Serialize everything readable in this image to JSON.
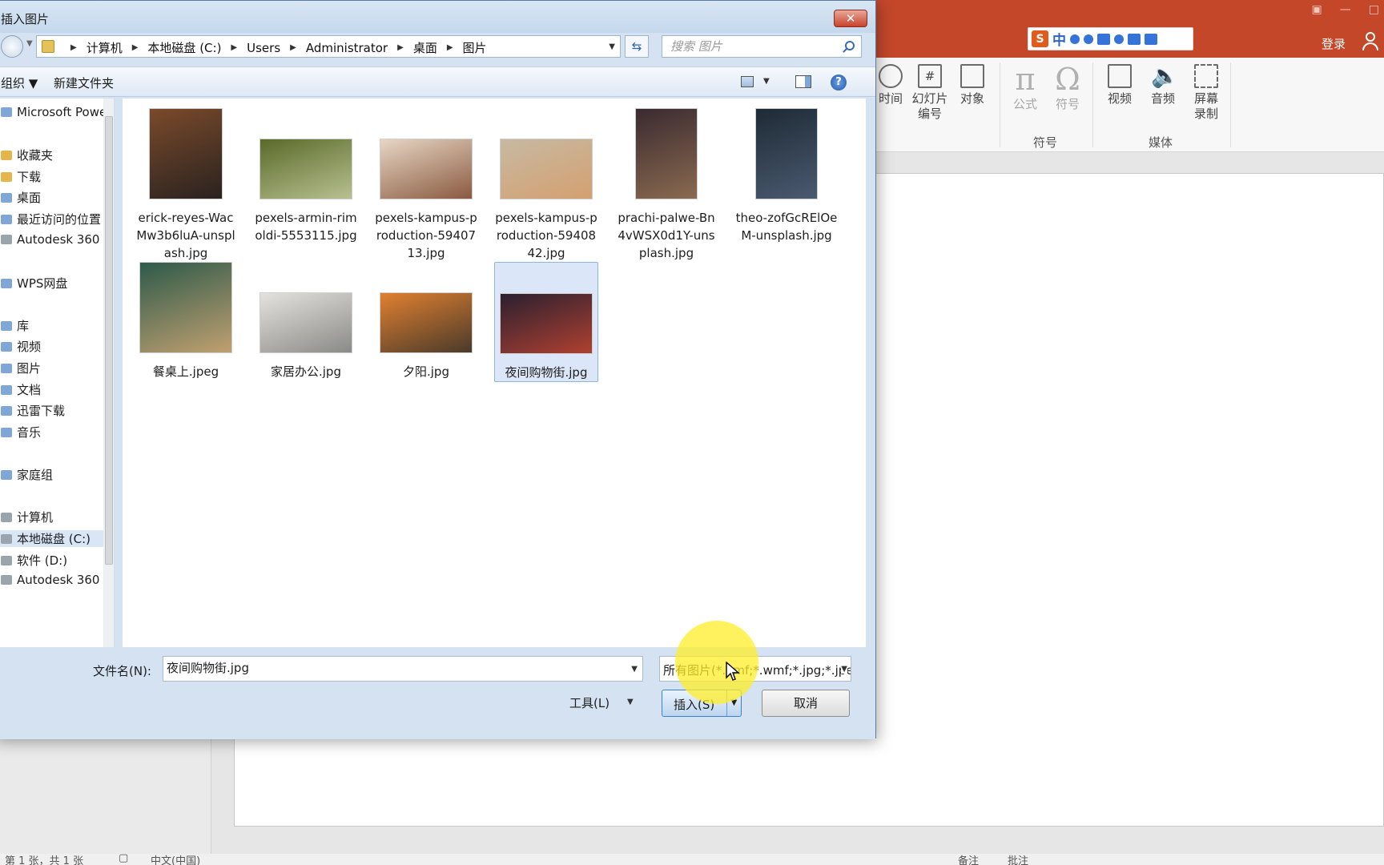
{
  "ppt": {
    "login_label": "登录",
    "ribbon": {
      "buttons": {
        "time": "时间",
        "slide_num_1": "幻灯片",
        "slide_num_2": "编号",
        "object": "对象",
        "equation": "公式",
        "symbol": "符号",
        "video": "视频",
        "audio": "音频",
        "screen_rec_1": "屏幕",
        "screen_rec_2": "录制"
      },
      "groups": {
        "symbols": "符号",
        "media": "媒体"
      }
    },
    "ime": {
      "zh": "中"
    },
    "status": {
      "slide_info": "第 1 张，共 1 张",
      "language": "中文(中国)",
      "notes": "备注",
      "comments": "批注"
    }
  },
  "dialog": {
    "title": "插入图片",
    "close_label": "✕",
    "breadcrumbs": [
      "计算机",
      "本地磁盘 (C:)",
      "Users",
      "Administrator",
      "桌面",
      "图片"
    ],
    "search_placeholder": "搜索 图片",
    "toolbar": {
      "organize": "组织 ▼",
      "new_folder": "新建文件夹"
    },
    "nav": {
      "items": [
        "Microsoft PowerPoint",
        "收藏夹",
        "下载",
        "桌面",
        "最近访问的位置",
        "Autodesk 360",
        "WPS网盘",
        "库",
        "视频",
        "图片",
        "文档",
        "迅雷下载",
        "音乐",
        "家庭组",
        "计算机",
        "本地磁盘 (C:)",
        "软件 (D:)",
        "Autodesk 360"
      ],
      "selected_index": 15
    },
    "files": [
      {
        "name": "erick-reyes-WacMw3b6luA-unsplash.jpg",
        "colors": [
          "#7a4a2a",
          "#2a2220"
        ]
      },
      {
        "name": "pexels-armin-rimoldi-5553115.jpg",
        "colors": [
          "#5a6a2a",
          "#b8c090"
        ]
      },
      {
        "name": "pexels-kampus-production-5940713.jpg",
        "colors": [
          "#e7d6c4",
          "#8a5a40"
        ]
      },
      {
        "name": "pexels-kampus-production-5940842.jpg",
        "colors": [
          "#c7b9a2",
          "#d4a070"
        ]
      },
      {
        "name": "prachi-palwe-Bn4vWSX0d1Y-unsplash.jpg",
        "colors": [
          "#3a2a30",
          "#8a6a50"
        ]
      },
      {
        "name": "theo-zofGcRElOeM-unsplash.jpg",
        "colors": [
          "#1e2a35",
          "#4a5a70"
        ]
      },
      {
        "name": "餐桌上.jpeg",
        "colors": [
          "#2e5a4a",
          "#c0a070"
        ]
      },
      {
        "name": "家居办公.jpg",
        "colors": [
          "#e4e2de",
          "#8a8a88"
        ]
      },
      {
        "name": "夕阳.jpg",
        "colors": [
          "#e08030",
          "#4a3a2a"
        ]
      },
      {
        "name": "夜间购物街.jpg",
        "colors": [
          "#2a2030",
          "#b04030"
        ]
      }
    ],
    "selected_file_index": 9,
    "filename_label": "文件名(N):",
    "filename_value": "夜间购物街.jpg",
    "filter_value": "所有图片(*.emf;*.wmf;*.jpg;*.jpeg",
    "tools_label": "工具(L)",
    "insert_label": "插入(S)",
    "cancel_label": "取消"
  }
}
